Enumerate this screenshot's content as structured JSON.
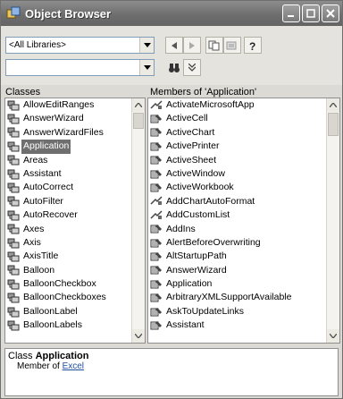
{
  "window": {
    "title": "Object Browser"
  },
  "toolbar": {
    "library_combo": "<All Libraries>",
    "search_combo": ""
  },
  "classes": {
    "header": "Classes",
    "items": [
      "AllowEditRanges",
      "AnswerWizard",
      "AnswerWizardFiles",
      "Application",
      "Areas",
      "Assistant",
      "AutoCorrect",
      "AutoFilter",
      "AutoRecover",
      "Axes",
      "Axis",
      "AxisTitle",
      "Balloon",
      "BalloonCheckbox",
      "BalloonCheckboxes",
      "BalloonLabel",
      "BalloonLabels"
    ],
    "selected_index": 3
  },
  "members": {
    "header": "Members of 'Application'",
    "items": [
      {
        "label": "ActivateMicrosoftApp",
        "kind": "method"
      },
      {
        "label": "ActiveCell",
        "kind": "property"
      },
      {
        "label": "ActiveChart",
        "kind": "property"
      },
      {
        "label": "ActivePrinter",
        "kind": "property"
      },
      {
        "label": "ActiveSheet",
        "kind": "property"
      },
      {
        "label": "ActiveWindow",
        "kind": "property"
      },
      {
        "label": "ActiveWorkbook",
        "kind": "property"
      },
      {
        "label": "AddChartAutoFormat",
        "kind": "method"
      },
      {
        "label": "AddCustomList",
        "kind": "method"
      },
      {
        "label": "AddIns",
        "kind": "property"
      },
      {
        "label": "AlertBeforeOverwriting",
        "kind": "property"
      },
      {
        "label": "AltStartupPath",
        "kind": "property"
      },
      {
        "label": "AnswerWizard",
        "kind": "property"
      },
      {
        "label": "Application",
        "kind": "property"
      },
      {
        "label": "ArbitraryXMLSupportAvailable",
        "kind": "property"
      },
      {
        "label": "AskToUpdateLinks",
        "kind": "property"
      },
      {
        "label": "Assistant",
        "kind": "property"
      }
    ]
  },
  "details": {
    "line1_prefix": "Class ",
    "line1_name": "Application",
    "line2_prefix": "Member of ",
    "line2_link": "Excel"
  }
}
